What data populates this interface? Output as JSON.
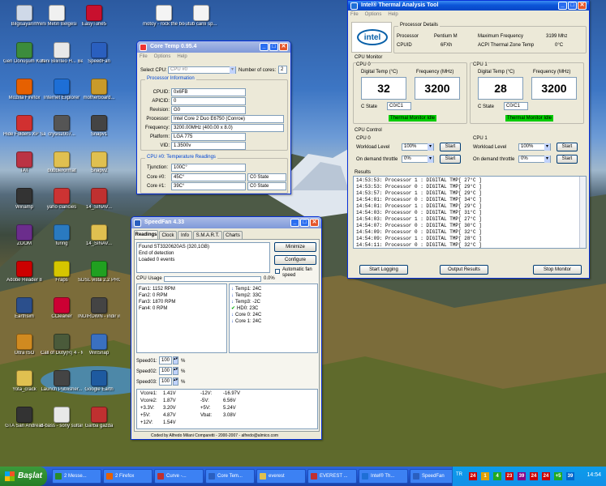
{
  "desktop": {
    "icons": [
      {
        "label": "Bilgisayarım",
        "color": "#cfd9e8"
      },
      {
        "label": "Yeni Metin Belgesi",
        "color": "#f0f0f0"
      },
      {
        "label": "EasyTune5",
        "color": "#c8102e"
      },
      {
        "label": "motoy - rock the body.vb...",
        "color": "#f4f4f4"
      },
      {
        "label": "utub canlı sp...",
        "color": "#f4f4f4"
      },
      {
        "label": "Geri Dönüşüm Kutusu",
        "color": "#3c8c3c"
      },
      {
        "label": "Yeni Bilinteo H... Belge",
        "color": "#e8e8e8"
      },
      {
        "label": "SpeedFan",
        "color": "#2a5fbf"
      },
      {
        "label": "Mozilla Firefox",
        "color": "#e66000"
      },
      {
        "label": "Internet Explorer",
        "color": "#1e6fd6"
      },
      {
        "label": "motherboard...",
        "color": "#c99a2a"
      },
      {
        "label": "Hide Folders XP Sam...",
        "color": "#d13030"
      },
      {
        "label": "crysis2007...",
        "color": "#555"
      },
      {
        "label": "Snapv1",
        "color": "#444"
      },
      {
        "label": "TAT",
        "color": "#b34"
      },
      {
        "label": "bubble/ormat",
        "color": "#e0c050"
      },
      {
        "label": "Snapv2",
        "color": "#e0c050"
      },
      {
        "label": "Winamp",
        "color": "#333"
      },
      {
        "label": "yaho clancies",
        "color": "#c33"
      },
      {
        "label": "14_SINAV...",
        "color": "#c03030"
      },
      {
        "label": "ZOOM",
        "color": "#6b2d8c"
      },
      {
        "label": "furing",
        "color": "#2a7ac0"
      },
      {
        "label": "14_SINAV...",
        "color": "#e0c050"
      },
      {
        "label": "Adobe Reader 8",
        "color": "#c00"
      },
      {
        "label": "Fraps",
        "color": "#d6c600"
      },
      {
        "label": "SDSL vista 2.2 PRO",
        "color": "#20a020"
      },
      {
        "label": "Earthsim",
        "color": "#2b4f8c"
      },
      {
        "label": "CCleaner",
        "color": "#c03"
      },
      {
        "label": "INDIRDWN - indir indirdi...",
        "color": "#444"
      },
      {
        "label": "Ultra ISO",
        "color": "#d08a20"
      },
      {
        "label": "Call of Duty(R) 4 - Modern...",
        "color": "#4a5a3a"
      },
      {
        "label": "WinSnap",
        "color": "#3a70c0"
      },
      {
        "label": "Yota_crack",
        "color": "#e0c050"
      },
      {
        "label": "Launch Publisher...",
        "color": "#444"
      },
      {
        "label": "Google Earth",
        "color": "#1e5aa0"
      },
      {
        "label": "GTA San Andreas",
        "color": "#333"
      },
      {
        "label": "d-bass - sony sultan car...",
        "color": "#e8e8e8"
      },
      {
        "label": "Garba gazda",
        "color": "#c03030"
      }
    ]
  },
  "coretemp": {
    "title": "Core Temp 0.95.4",
    "menu": [
      "File",
      "Options",
      "Help"
    ],
    "select_cpu_label": "Select CPU:",
    "select_cpu_value": "CPU #0",
    "cores_label": "Number of cores:",
    "cores_value": "2",
    "info_title": "Processor Information",
    "rows": [
      {
        "label": "CPUID:",
        "value": "0x6FB"
      },
      {
        "label": "APICID:",
        "value": "0"
      },
      {
        "label": "Revision:",
        "value": "G0"
      },
      {
        "label": "Processor:",
        "value": "Intel Core 2 Duo E6750 (Conroe)"
      },
      {
        "label": "Frequency:",
        "value": "3200.00MHz (400.00 x 8.0)"
      },
      {
        "label": "Platform:",
        "value": "LGA 775"
      },
      {
        "label": "VID:",
        "value": "1.3500v"
      }
    ],
    "temp_title": "CPU #0: Temperature Readings",
    "tjunction_label": "Tjunction:",
    "tjunction_value": "100C°",
    "cores": [
      {
        "label": "Core #0:",
        "temp": "45C°",
        "state": "C0 State"
      },
      {
        "label": "Core #1:",
        "temp": "39C°",
        "state": "C0 State"
      }
    ]
  },
  "speedfan": {
    "title": "SpeedFan 4.33",
    "tabs": [
      "Readings",
      "Clock",
      "Info",
      "S.M.A.R.T.",
      "Charts"
    ],
    "log": [
      "Found ST3320620AS (320,1GB)",
      "End of detection",
      "Loaded 0 events"
    ],
    "minimize": "Minimize",
    "configure": "Configure",
    "auto_fan": "Automatic fan speed",
    "cpu_usage_label": "CPU Usage",
    "cpu_usage_value": "0.0%",
    "cpu_usage_fraction": 0.0,
    "fans": [
      "Fan1: 1152 RPM",
      "Fan2: 0 RPM",
      "Fan3: 1870 RPM",
      "Fan4: 0 RPM"
    ],
    "temps": [
      {
        "arrow": "down",
        "label": "Temp1: 24C"
      },
      {
        "arrow": "down",
        "label": "Temp2: 33C"
      },
      {
        "arrow": "down",
        "label": "Temp3: -2C"
      },
      {
        "arrow": "check",
        "label": "HD0: 23C"
      },
      {
        "arrow": "down",
        "label": "Core 0: 24C"
      },
      {
        "arrow": "down",
        "label": "Core 1: 24C"
      }
    ],
    "speeds": [
      {
        "label": "Speed01:",
        "value": "100",
        "unit": "%"
      },
      {
        "label": "Speed02:",
        "value": "100",
        "unit": "%"
      },
      {
        "label": "Speed03:",
        "value": "100",
        "unit": "%"
      }
    ],
    "volts": [
      [
        "Vcore1:",
        "1.41V",
        "-12V:",
        "-16.97V"
      ],
      [
        "Vcore2:",
        "1.87V",
        "-5V:",
        "6.56V"
      ],
      [
        "+3.3V:",
        "3.20V",
        "+5V:",
        "5.24V"
      ],
      [
        "+5V:",
        "4.87V",
        "Vbat:",
        "3.08V"
      ],
      [
        "+12V:",
        "1.54V",
        "",
        ""
      ]
    ],
    "footer": "Coded by Alfredo Milani Comparetti - 2000-2007 - alfredo@almico.com"
  },
  "intel": {
    "title": "Intel® Thermal Analysis Tool",
    "menu": [
      "File",
      "Options",
      "Help"
    ],
    "logo": "intel",
    "details_title": "Processor Details",
    "processor_label": "Processor",
    "processor_value": "Pentium M",
    "cpuid_label": "CPUID",
    "cpuid_value": "6FXh",
    "maxfreq_label": "Maximum Frequency",
    "maxfreq_value": "3199 Mhz",
    "acpi_label": "ACPI Thermal Zone Temp",
    "acpi_value": "0°C",
    "monitor_title": "CPU Monitor",
    "cpus": [
      {
        "name": "CPU 0",
        "temp_label": "Digital Temp (°C)",
        "freq_label": "Frequency (MHz)",
        "temp": "32",
        "freq": "3200",
        "cstate_label": "C State",
        "cstate": "C0/C1",
        "status": "Thermal Monitor Idle"
      },
      {
        "name": "CPU 1",
        "temp_label": "Digital Temp (°C)",
        "freq_label": "Frequency (MHz)",
        "temp": "28",
        "freq": "3200",
        "cstate_label": "C State",
        "cstate": "C0/C1",
        "status": "Thermal Monitor Idle"
      }
    ],
    "control_title": "CPU Control",
    "controls": [
      {
        "name": "CPU 0",
        "workload_label": "Workload Level",
        "workload": "100%",
        "throttle_label": "On demand throttle",
        "throttle": "0%",
        "start": "Start"
      },
      {
        "name": "CPU 1",
        "workload_label": "Workload Level",
        "workload": "100%",
        "throttle_label": "On demand throttle",
        "throttle": "0%",
        "start": "Start"
      }
    ],
    "results_title": "Results",
    "results": [
      "14:53:53: Processor 1 : DIGITAL TMP[ 27°C ]",
      "14:53:53: Processor 0 : DIGITAL TMP[ 29°C ]",
      "14:53:57: Processor 1 : DIGITAL TMP[ 29°C ]",
      "14:54:01: Processor 0 : DIGITAL TMP[ 34°C ]",
      "14:54:01: Processor 1 : DIGITAL TMP[ 29°C ]",
      "14:54:03: Processor 0 : DIGITAL TMP[ 31°C ]",
      "14:54:03: Processor 1 : DIGITAL TMP[ 27°C ]",
      "14:54:07: Processor 0 : DIGITAL TMP[ 30°C ]",
      "14:54:09: Processor 0 : DIGITAL TMP[ 32°C ]",
      "14:54:09: Processor 1 : DIGITAL TMP[ 28°C ]",
      "14:54:11: Processor 0 : DIGITAL TMP[ 32°C ]"
    ],
    "start_logging": "Start Logging",
    "output_results": "Output Results",
    "stop_monitor": "Stop Monitor"
  },
  "taskbar": {
    "start": "Başlat",
    "buttons": [
      {
        "label": "2 Messe...",
        "color": "#2a8c2a"
      },
      {
        "label": "2 Firefox",
        "color": "#e66000"
      },
      {
        "label": "Curve -...",
        "color": "#c03030"
      },
      {
        "label": "Core Tem...",
        "color": "#2a5fbf"
      },
      {
        "label": "everest",
        "color": "#e0c050"
      },
      {
        "label": "EVEREST ...",
        "color": "#c03030"
      },
      {
        "label": "Intel® Th...",
        "color": "#1e6fd6"
      },
      {
        "label": "SpeedFan",
        "color": "#2a5fbf"
      }
    ],
    "lang": "TR",
    "tray_numbers": [
      "24",
      "1",
      "4",
      "23",
      "39",
      "24",
      "24",
      "+5",
      "39"
    ],
    "clock": "14:54"
  }
}
